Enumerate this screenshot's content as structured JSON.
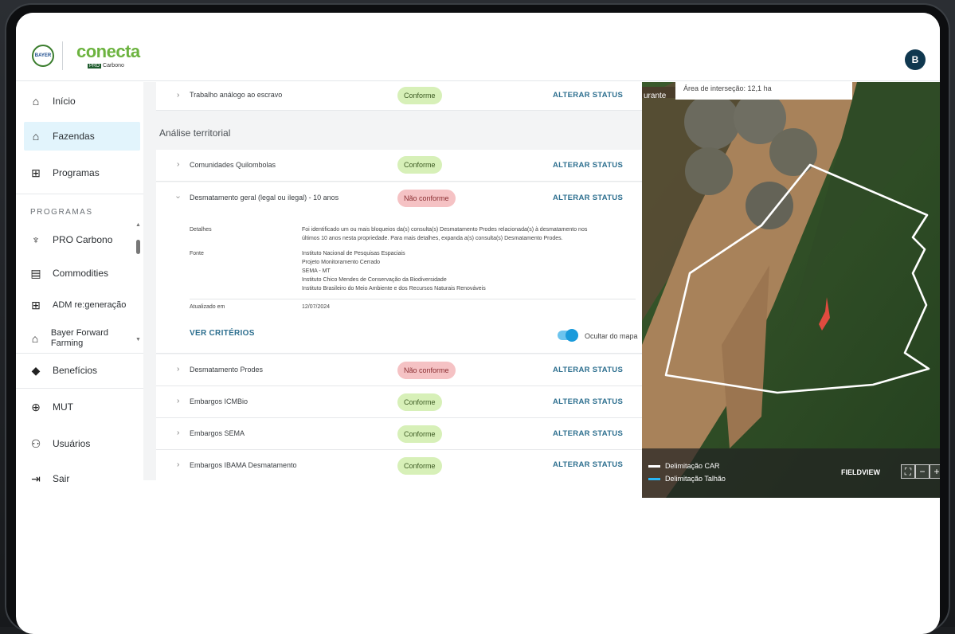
{
  "header": {
    "brand": "conecta",
    "brand_sub_pro": "PRO",
    "brand_sub": "Carbono",
    "bayer_text": "BAYER",
    "avatar": "B"
  },
  "sidebar": {
    "items": [
      {
        "label": "Início",
        "icon": "home-icon"
      },
      {
        "label": "Fazendas",
        "icon": "farm-icon"
      },
      {
        "label": "Programas",
        "icon": "grid-icon"
      }
    ],
    "programs_label": "PROGRAMAS",
    "programs": [
      {
        "label": "PRO Carbono",
        "icon": "sprout-icon"
      },
      {
        "label": "Commodities",
        "icon": "doc-icon"
      },
      {
        "label": "ADM re:generação",
        "icon": "grid-icon"
      },
      {
        "label": "Bayer Forward Farming",
        "icon": "home-outline-icon"
      }
    ],
    "bottom": [
      {
        "label": "Benefícios",
        "icon": "tag-icon"
      },
      {
        "label": "MUT",
        "icon": "globe-icon"
      },
      {
        "label": "Usuários",
        "icon": "user-icon"
      },
      {
        "label": "Sair",
        "icon": "logout-icon"
      }
    ]
  },
  "main": {
    "alter_label": "ALTERAR STATUS",
    "row_top": {
      "title": "Trabalho análogo ao escravo",
      "status": "Conforme"
    },
    "section_title": "Análise territorial",
    "rows": [
      {
        "title": "Comunidades Quilombolas",
        "status": "Conforme"
      },
      {
        "title": "Desmatamento geral (legal ou ilegal) - 10 anos",
        "status": "Não conforme"
      },
      {
        "title": "Desmatamento Prodes",
        "status": "Não conforme"
      },
      {
        "title": "Embargos ICMBio",
        "status": "Conforme"
      },
      {
        "title": "Embargos SEMA",
        "status": "Conforme"
      },
      {
        "title": "Embargos IBAMA Desmatamento",
        "status": "Conforme"
      }
    ],
    "details": {
      "details_label": "Detalhes",
      "details_text_1": "Foi identificado um ou mais bloqueios da(s) consulta(s) Desmatamento Prodes relacionada(s) à desmatamento nos",
      "details_text_2": "últimos 10 anos nesta propriedade. Para mais detalhes, expanda a(s) consulta(s) Desmatamento Prodes.",
      "source_label": "Fonte",
      "sources": [
        "Instituto Nacional de Pesquisas Espaciais",
        "Projeto Monitoramento Cerrado",
        "SEMA - MT",
        "Instituto Chico Mendes de Conservação da Biodiversidade",
        "Instituto Brasileiro do Meio Ambiente e dos Recursos Naturais Renováveis"
      ],
      "updated_label": "Atualizado em",
      "updated_value": "12/07/2024",
      "criteria_label": "VER CRITÉRIOS",
      "toggle_label": "Ocultar do mapa"
    }
  },
  "map": {
    "tooltip": "Área de interseção: 12,1 ha",
    "place_label": "urante",
    "legend": [
      {
        "label": "Delimitação CAR",
        "color": "#ffffff"
      },
      {
        "label": "Delimitação Talhão",
        "color": "#29b6f6"
      }
    ],
    "brand": "FIELDVIEW",
    "zoom_out": "−",
    "zoom_in": "+"
  }
}
